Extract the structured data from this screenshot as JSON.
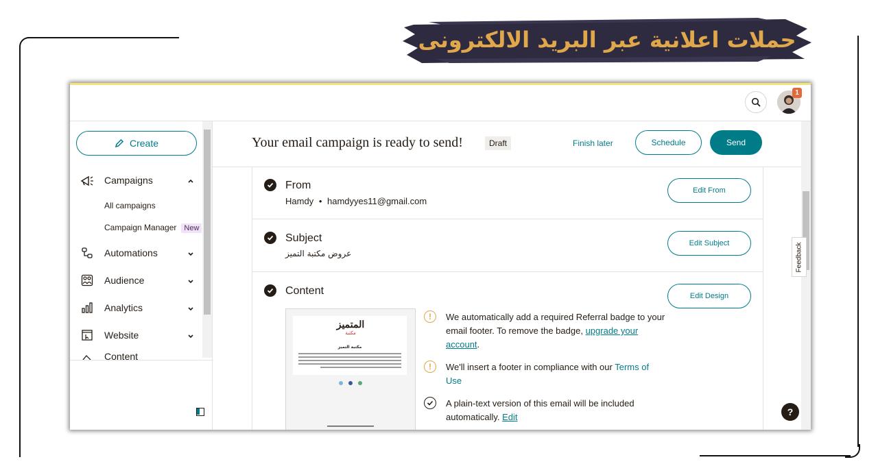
{
  "banner": {
    "title": "حملات اعلانية عبر البريد الالكترونى"
  },
  "colors": {
    "accent": "#007c89",
    "banner_bg": "#2e2b40",
    "banner_text": "#e0a84b",
    "draft_bg": "#efeeea",
    "new_badge_bg": "#f1e3f7"
  },
  "topbar": {
    "search_icon": "search-icon",
    "notification_count": "1"
  },
  "sidebar": {
    "create_label": "Create",
    "items": [
      {
        "label": "Campaigns",
        "icon": "megaphone-icon",
        "expanded": true
      },
      {
        "label": "Automations",
        "icon": "automation-icon",
        "expanded": false
      },
      {
        "label": "Audience",
        "icon": "audience-icon",
        "expanded": false
      },
      {
        "label": "Analytics",
        "icon": "bar-chart-icon",
        "expanded": false
      },
      {
        "label": "Website",
        "icon": "website-icon",
        "expanded": false
      },
      {
        "label": "Content",
        "icon": "content-icon",
        "expanded": false
      }
    ],
    "subitems": [
      {
        "label": "All campaigns"
      },
      {
        "label": "Campaign Manager",
        "badge": "New"
      }
    ]
  },
  "header": {
    "title": "Your email campaign is ready to send!",
    "status": "Draft",
    "finish_later": "Finish later",
    "schedule": "Schedule",
    "send": "Send"
  },
  "sections": {
    "from": {
      "title": "From",
      "name": "Hamdy",
      "separator": "•",
      "email": "hamdyyes11@gmail.com",
      "button": "Edit From"
    },
    "subject": {
      "title": "Subject",
      "value": "عروض مكتبة التميز",
      "button": "Edit Subject"
    },
    "content": {
      "title": "Content",
      "button": "Edit Design",
      "preview": {
        "logo_text": "المتميز",
        "logo_sub": "مكتبة",
        "heading": "مكتبة التميز"
      },
      "notices": [
        {
          "icon": "warning-icon",
          "text": "We automatically add a required Referral badge to your email footer. To remove the badge,",
          "link": "upgrade your account",
          "suffix": "."
        },
        {
          "icon": "warning-icon",
          "text": "We'll insert a footer in compliance with our",
          "link": "Terms of Use",
          "suffix": ""
        },
        {
          "icon": "check-circle-icon",
          "text": "A plain-text version of this email will be included automatically.",
          "link": "Edit",
          "suffix": ""
        }
      ]
    }
  },
  "feedback": "Feedback",
  "help": "?"
}
